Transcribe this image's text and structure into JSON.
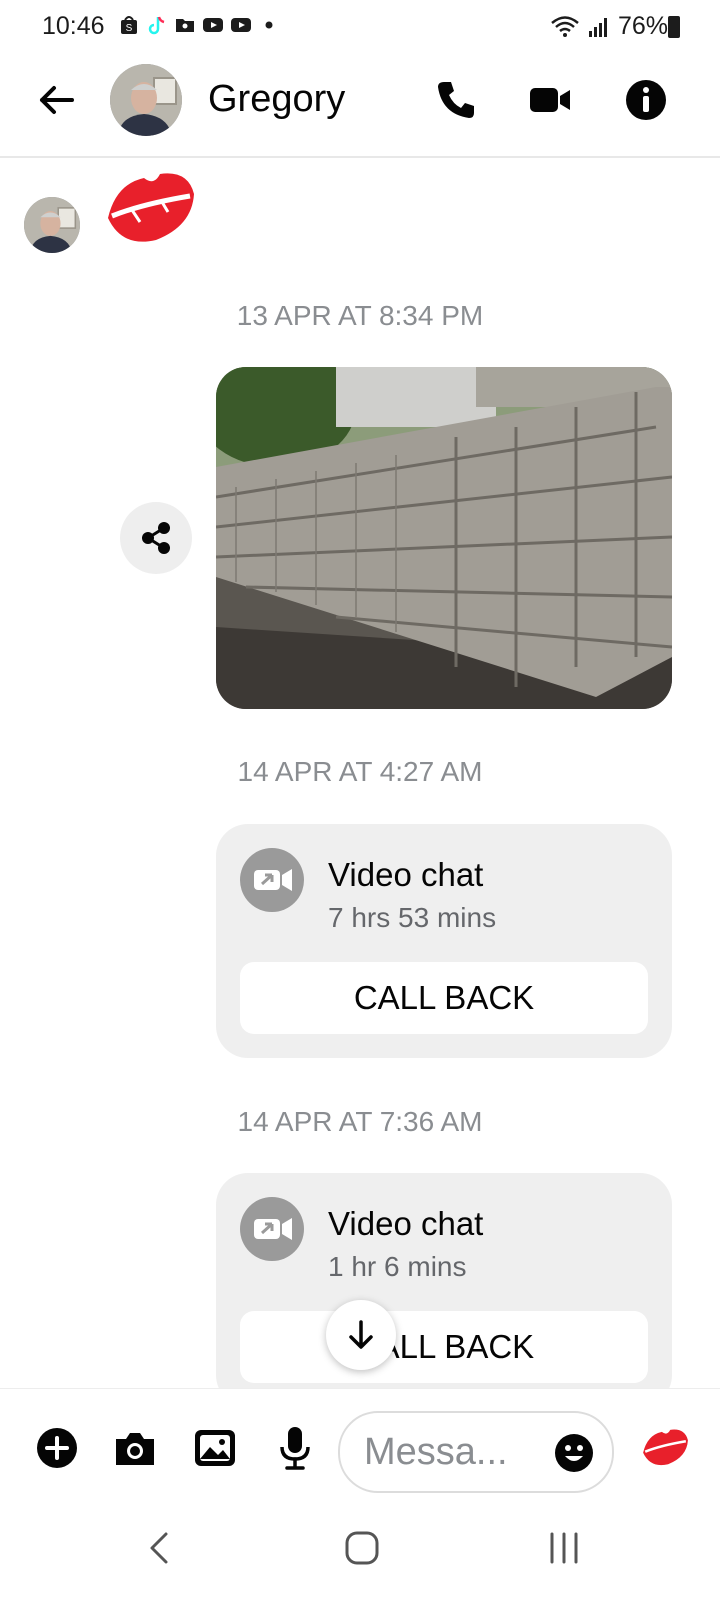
{
  "status_bar": {
    "time": "10:46",
    "battery": "76%",
    "left_icons": [
      "shopping-bag-icon",
      "tiktok-icon",
      "folder-icon",
      "youtube-icon",
      "youtube-icon",
      "dot-icon"
    ],
    "right_icons": [
      "wifi-icon",
      "signal-icon",
      "battery-icon"
    ]
  },
  "header": {
    "contact_name": "Gregory",
    "icons": [
      "back-arrow-icon",
      "phone-icon",
      "video-camera-icon",
      "info-icon"
    ]
  },
  "messages": {
    "sticker": "kiss-lips-icon",
    "ts1": "13 APR AT 8:34 PM",
    "ts2": "14 APR AT 4:27 AM",
    "ts3": "14 APR AT 7:36 AM",
    "call1": {
      "title": "Video chat",
      "duration": "7 hrs 53 mins",
      "button": "CALL BACK"
    },
    "call2": {
      "title": "Video chat",
      "duration": "1 hr 6 mins",
      "button": "CALL BACK"
    }
  },
  "composer": {
    "placeholder": "Messa...",
    "icons": [
      "plus-icon",
      "camera-icon",
      "gallery-icon",
      "microphone-icon",
      "emoji-icon",
      "kiss-lips-icon"
    ]
  },
  "colors": {
    "bubble": "#efefef",
    "timestamp": "#8a8d91",
    "lips": "#e8202b"
  }
}
